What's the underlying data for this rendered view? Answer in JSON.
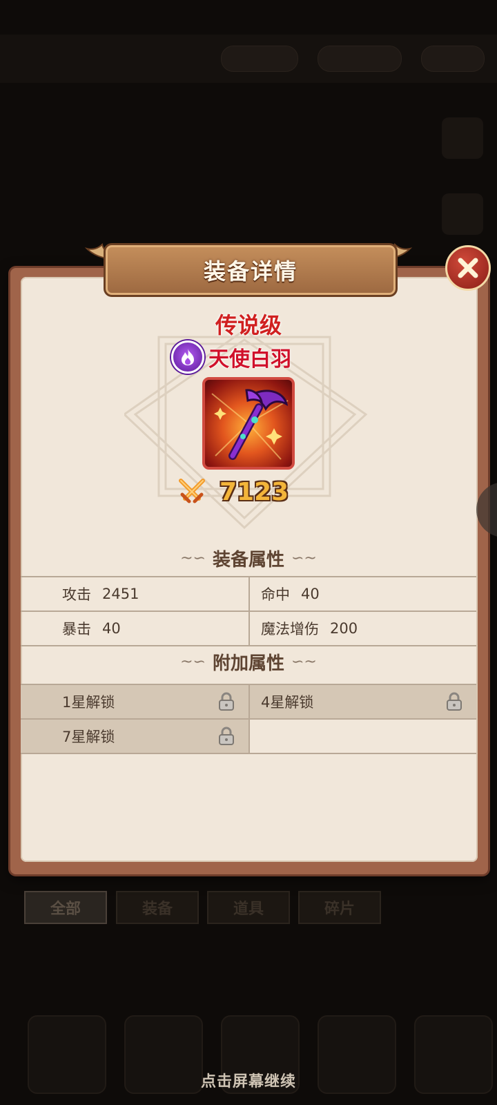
{
  "background": {
    "tabs": [
      "全部",
      "装备",
      "道具",
      "碎片"
    ],
    "continue_hint": "点击屏幕继续"
  },
  "dialog": {
    "title": "装备详情",
    "rarity": "传说级",
    "item_name": "天使白羽",
    "element_icon": "flame-element-icon",
    "power_icon": "crossed-swords-icon",
    "power": "7123",
    "colors": {
      "rarity": "#d02020",
      "frame": "#d14a40",
      "power": "#f3b53a"
    },
    "base_section_title": "装备属性",
    "base_stats": [
      {
        "label": "攻击",
        "value": "2451"
      },
      {
        "label": "命中",
        "value": "40"
      },
      {
        "label": "暴击",
        "value": "40"
      },
      {
        "label": "魔法增伤",
        "value": "200"
      }
    ],
    "extra_section_title": "附加属性",
    "extra_stats": [
      {
        "label": "1星解锁",
        "locked": true
      },
      {
        "label": "4星解锁",
        "locked": true
      },
      {
        "label": "7星解锁",
        "locked": true
      }
    ]
  }
}
